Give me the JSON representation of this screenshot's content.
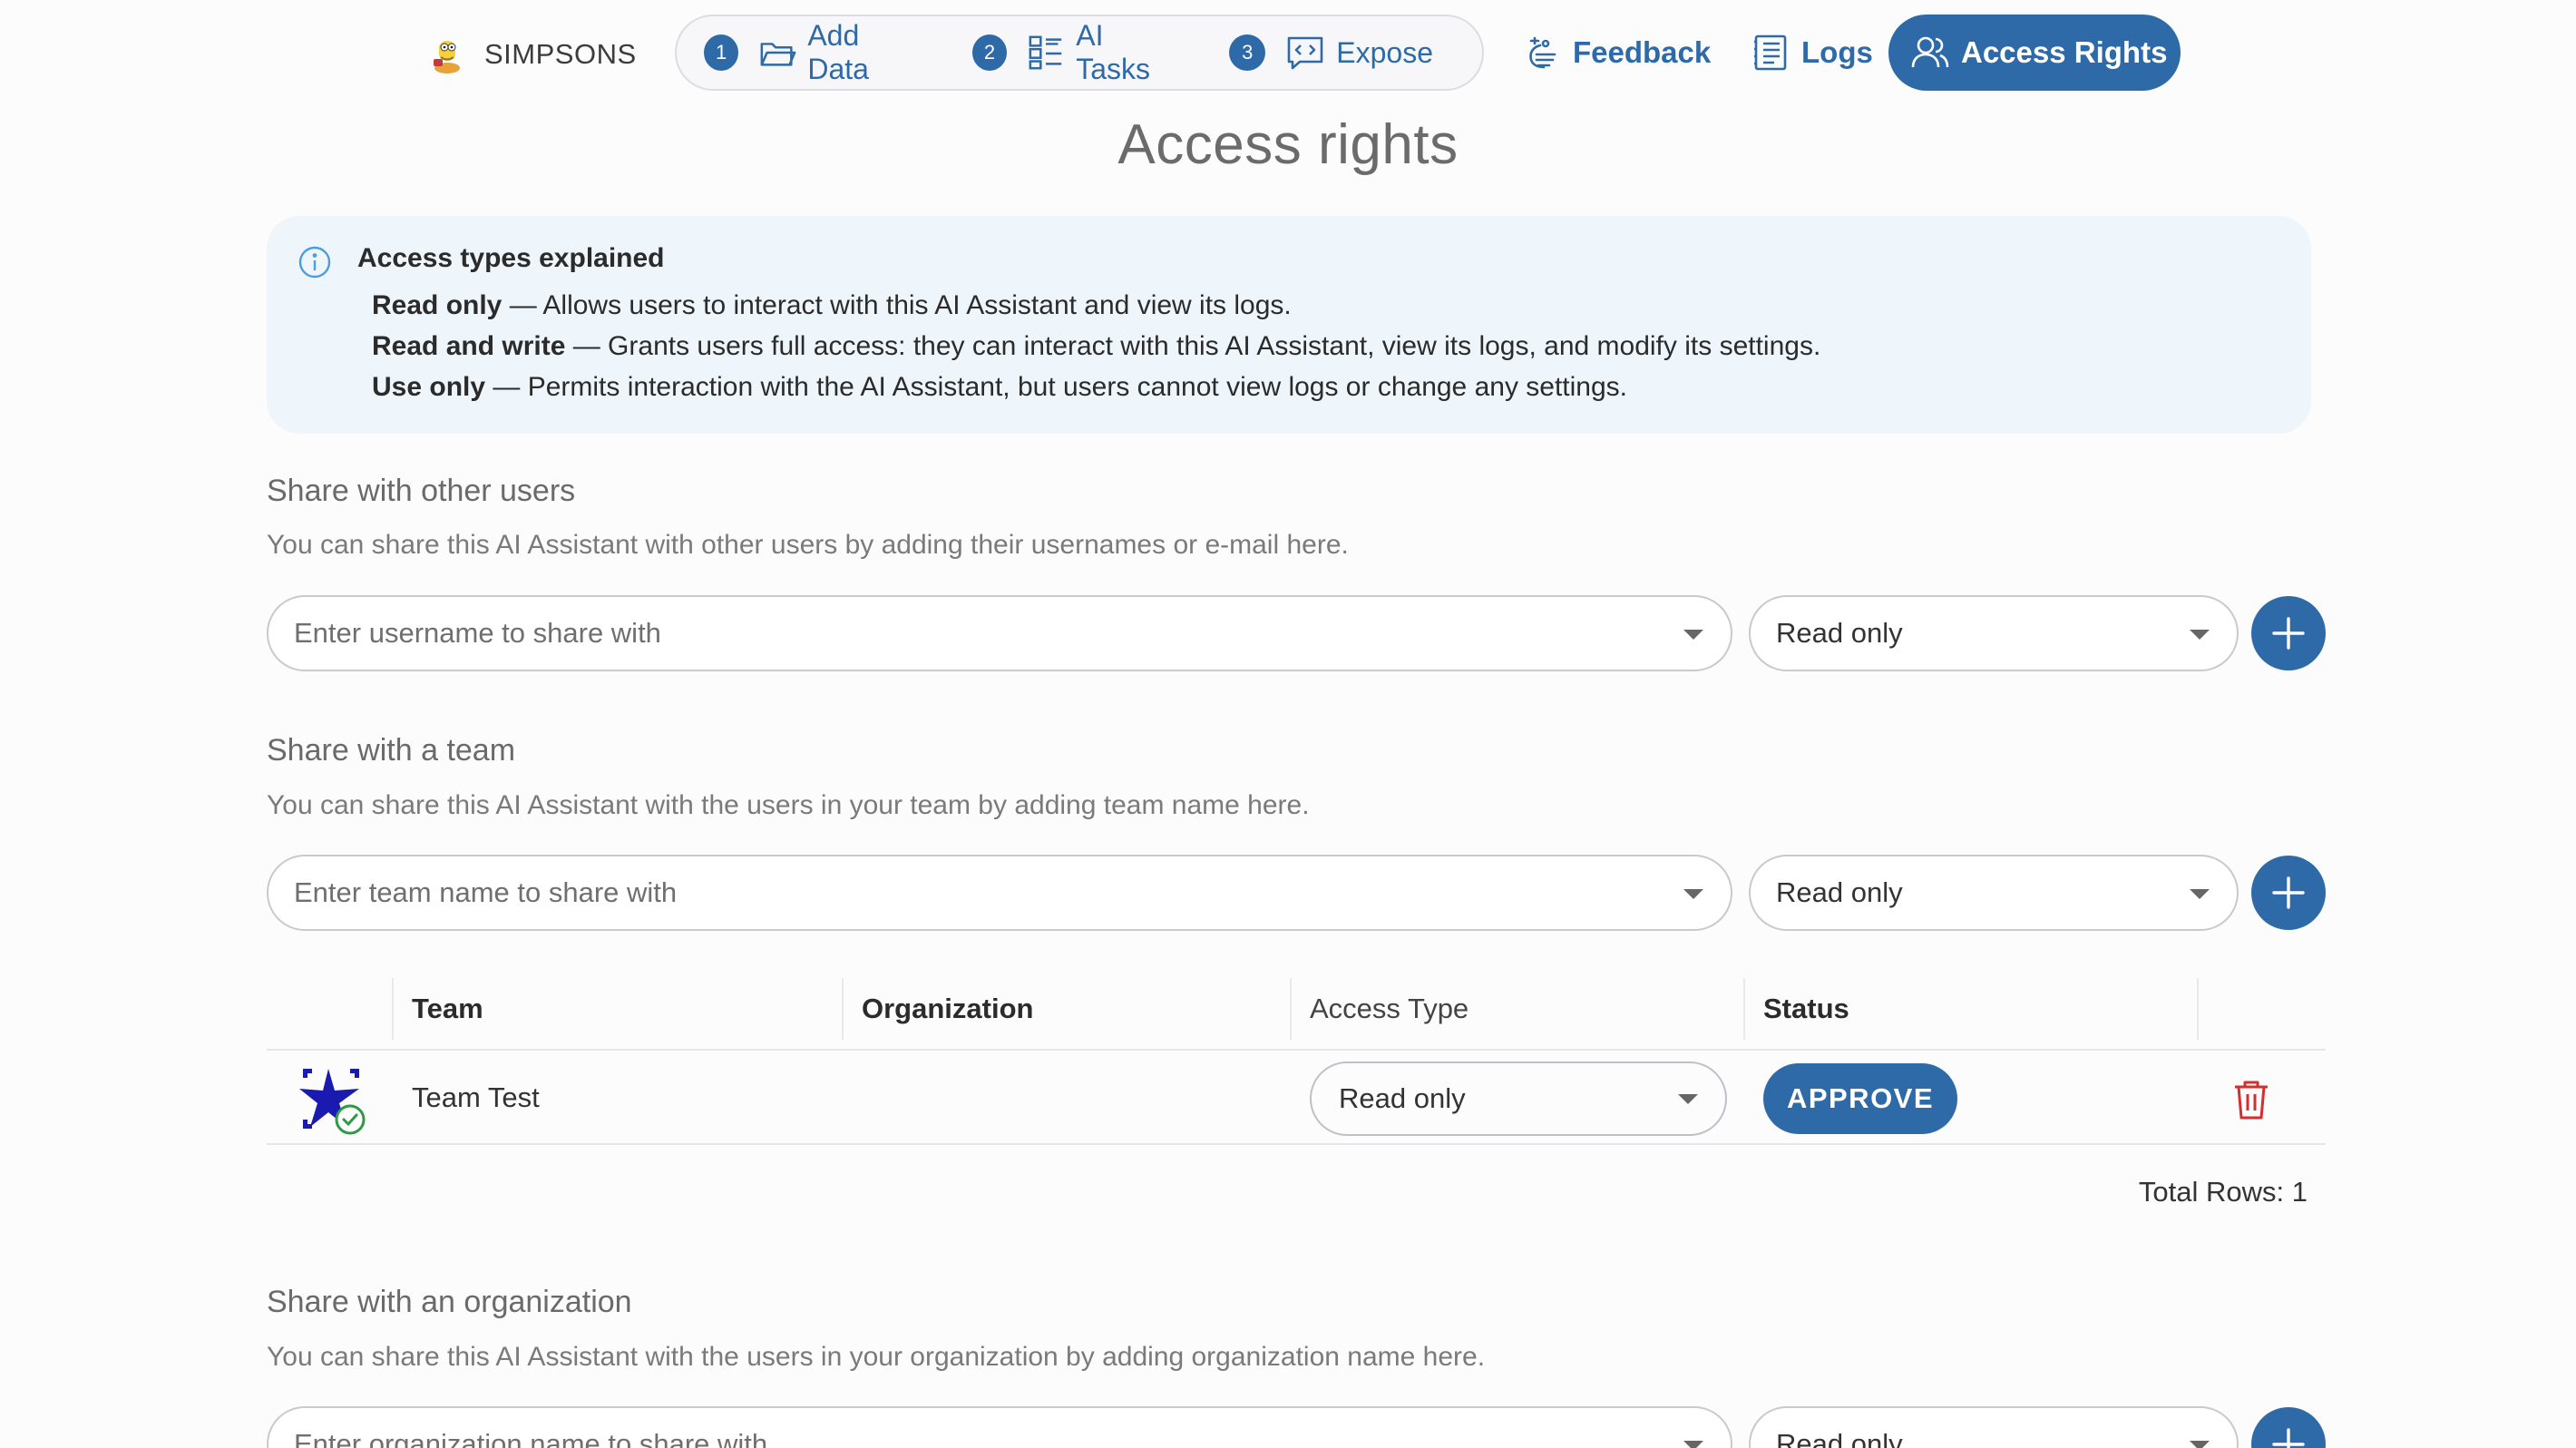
{
  "brand": {
    "name": "SIMPSONS"
  },
  "steps": [
    {
      "num": "1",
      "label": "Add Data",
      "icon": "folder-open-icon"
    },
    {
      "num": "2",
      "label": "AI Tasks",
      "icon": "task-list-icon"
    },
    {
      "num": "3",
      "label": "Expose",
      "icon": "code-message-icon"
    }
  ],
  "nav": {
    "feedback": "Feedback",
    "logs": "Logs",
    "access_rights": "Access Rights"
  },
  "page_title": "Access rights",
  "info": {
    "heading": "Access types explained",
    "lines": [
      {
        "term": "Read only",
        "desc": " — Allows users to interact with this AI Assistant and view its logs."
      },
      {
        "term": "Read and write",
        "desc": " — Grants users full access: they can interact with this AI Assistant, view its logs, and modify its settings."
      },
      {
        "term": "Use only",
        "desc": " — Permits interaction with the AI Assistant, but users cannot view logs or change any settings."
      }
    ]
  },
  "share_users": {
    "title": "Share with other users",
    "description": "You can share this AI Assistant with other users by adding their usernames or e-mail here.",
    "placeholder": "Enter username to share with",
    "access": "Read only"
  },
  "share_team": {
    "title": "Share with a team",
    "description": "You can share this AI Assistant with the users in your team by adding team name here.",
    "placeholder": "Enter team name to share with",
    "access": "Read only"
  },
  "table": {
    "headers": [
      "Team",
      "Organization",
      "Access Type",
      "Status"
    ],
    "rows": [
      {
        "team": "Team Test",
        "organization": "",
        "access_type": "Read only",
        "status_action": "APPROVE"
      }
    ],
    "total_rows": "Total Rows: 1"
  },
  "share_org": {
    "title": "Share with an organization",
    "description": "You can share this AI Assistant with the users in your organization by adding organization name here.",
    "placeholder": "Enter organization name to share with",
    "access": "Read only"
  },
  "colors": {
    "primary": "#2e6aa8",
    "info_bg": "#eef6fc",
    "danger": "#d32f2f",
    "success": "#2e9a45"
  }
}
